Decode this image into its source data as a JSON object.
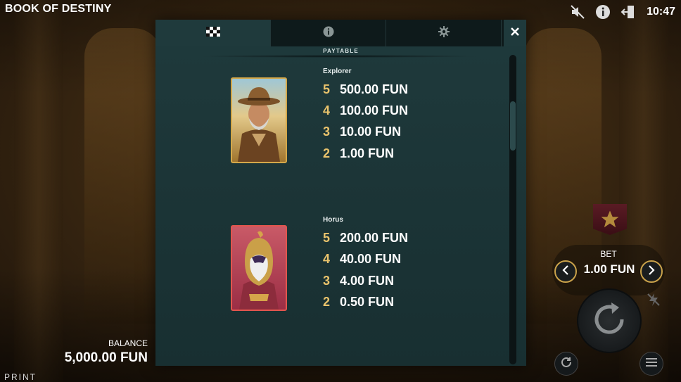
{
  "header": {
    "title": "BOOK OF DESTINY",
    "time": "10:47",
    "icons": [
      "sound-off-icon",
      "info-icon",
      "exit-icon"
    ]
  },
  "modal": {
    "tabs": [
      {
        "name": "paytable-tab",
        "icon": "checkered-icon",
        "active": true
      },
      {
        "name": "info-tab",
        "icon": "info-icon",
        "active": false
      },
      {
        "name": "settings-tab",
        "icon": "gear-icon",
        "active": false
      }
    ],
    "section_label": "PAYTABLE",
    "symbols": [
      {
        "name": "Explorer",
        "payouts": [
          {
            "count": "5",
            "value": "500.00 FUN"
          },
          {
            "count": "4",
            "value": "100.00 FUN"
          },
          {
            "count": "3",
            "value": "10.00 FUN"
          },
          {
            "count": "2",
            "value": "1.00 FUN"
          }
        ]
      },
      {
        "name": "Horus",
        "payouts": [
          {
            "count": "5",
            "value": "200.00 FUN"
          },
          {
            "count": "4",
            "value": "40.00 FUN"
          },
          {
            "count": "3",
            "value": "4.00 FUN"
          },
          {
            "count": "2",
            "value": "0.50 FUN"
          }
        ]
      }
    ]
  },
  "balance": {
    "label": "BALANCE",
    "value": "5,000.00 FUN"
  },
  "print_label": "PRINT",
  "bet": {
    "label": "BET",
    "value": "1.00 FUN"
  },
  "colors": {
    "accent_gold": "#e9c36c",
    "modal_bg": "#1f3a3c",
    "horus_border": "#e2554e",
    "explorer_border": "#d4a84a"
  }
}
